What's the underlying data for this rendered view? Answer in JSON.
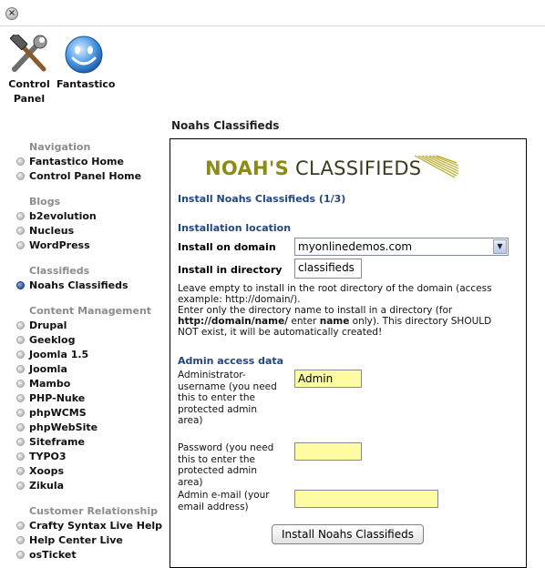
{
  "toolbar": {
    "control_panel_line1": "Control",
    "control_panel_line2": "Panel",
    "fantastico_label": "Fantastico"
  },
  "page_title": "Noahs Classifieds",
  "sidebar": {
    "navigation_head": "Navigation",
    "navigation": [
      "Fantastico Home",
      "Control Panel Home"
    ],
    "blogs_head": "Blogs",
    "blogs": [
      "b2evolution",
      "Nucleus",
      "WordPress"
    ],
    "classifieds_head": "Classifieds",
    "classifieds": [
      "Noahs Classifieds"
    ],
    "cms_head": "Content Management",
    "cms": [
      "Drupal",
      "Geeklog",
      "Joomla 1.5",
      "Joomla",
      "Mambo",
      "PHP-Nuke",
      "phpWCMS",
      "phpWebSite",
      "Siteframe",
      "TYPO3",
      "Xoops",
      "Zikula"
    ],
    "crm_head": "Customer Relationship",
    "crm": [
      "Crafty Syntax Live Help",
      "Help Center Live",
      "osTicket"
    ]
  },
  "form": {
    "logo_part1": "NOAH'S",
    "logo_part2": "CLASSIFIEDS",
    "step_title": "Install Noahs Classifieds (1/3)",
    "location_head": "Installation location",
    "domain_label": "Install on domain",
    "domain_value": "myonlinedemos.com",
    "directory_label": "Install in directory",
    "directory_value": "classifieds",
    "help_line1": "Leave empty to install in the root directory of the domain (access",
    "help_line2": "example: http://domain/).",
    "help_line3": "Enter only the directory name to install in a directory (for",
    "help_line4_bold1": "http://domain/name/",
    "help_line4_mid": " enter ",
    "help_line4_bold2": "name",
    "help_line4_end": " only). This directory SHOULD",
    "help_line5": "NOT exist, it will be automatically created!",
    "admin_head": "Admin access data",
    "admin_user_l1": "Administrator-",
    "admin_user_l2": "username (you need",
    "admin_user_l3": "this to enter the",
    "admin_user_l4": "protected admin",
    "admin_user_l5": "area)",
    "admin_user_value": "Admin",
    "password_l1": "Password (you need",
    "password_l2": "this to enter the",
    "password_l3": "protected admin",
    "password_l4": "area)",
    "password_value": "",
    "email_l1": "Admin e-mail (your",
    "email_l2": "email address)",
    "email_value": "",
    "install_button": "Install Noahs Classifieds"
  },
  "colors": {
    "accent_blue": "#24467e",
    "input_yellow": "#fefca3",
    "logo_olive": "#8a8c13"
  }
}
